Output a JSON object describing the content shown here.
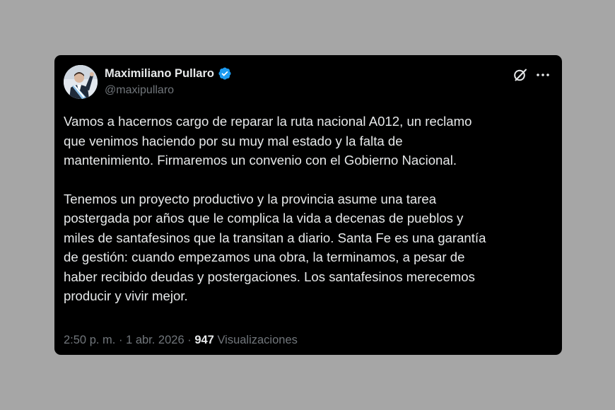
{
  "author": {
    "name": "Maximiliano Pullaro",
    "handle": "@maxipullaro",
    "verified": true,
    "verified_color": "#1d9bf0"
  },
  "header_icons": {
    "grok": "grok-icon",
    "more": "more-options-icon"
  },
  "tweet": {
    "paragraphs": [
      "Vamos a hacernos cargo de reparar la ruta nacional A012, un reclamo\nque venimos haciendo por su muy mal estado y la falta de\nmantenimiento. Firmaremos un convenio con el Gobierno Nacional.",
      "Tenemos un proyecto productivo y la provincia asume una tarea\npostergada por años que le complica la vida a decenas de pueblos y\nmiles de santafesinos que la transitan a diario. Santa Fe es una garantía\nde gestión: cuando empezamos una obra, la terminamos, a pesar de\nhaber recibido deudas y postergaciones. Los santafesinos merecemos\nproducir y vivir mejor."
    ]
  },
  "meta": {
    "time": "2:50 p. m.",
    "separator": "·",
    "date": "1 abr. 2026",
    "views_count": "947",
    "views_label": "Visualizaciones"
  },
  "colors": {
    "background": "#a6a6a6",
    "card": "#000000",
    "text": "#e7e9ea",
    "muted": "#71767b",
    "accent": "#1d9bf0"
  }
}
